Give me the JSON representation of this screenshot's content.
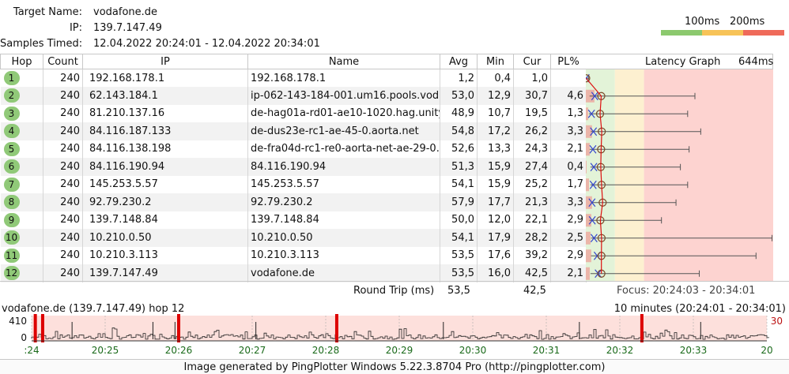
{
  "info": {
    "target_label": "Target Name:",
    "target_value": "vodafone.de",
    "ip_label": "IP:",
    "ip_value": "139.7.147.49",
    "samples_label": "Samples Timed:",
    "samples_value": "12.04.2022 20:24:01 - 12.04.2022 20:34:01"
  },
  "legend": {
    "label_100": "100ms",
    "label_200": "200ms",
    "colors": {
      "good": "#8cc96e",
      "warn": "#f7c358",
      "bad": "#ef6a5a"
    }
  },
  "table": {
    "headers": {
      "hop": "Hop",
      "count": "Count",
      "ip": "IP",
      "name": "Name",
      "avg": "Avg",
      "min": "Min",
      "cur": "Cur",
      "pl": "PL%",
      "graph": "Latency Graph",
      "scale": "644ms"
    },
    "rows": [
      {
        "hop": "1",
        "count": "240",
        "ip": "192.168.178.1",
        "name": "192.168.178.1",
        "avg": "1,2",
        "min": "0,4",
        "cur": "1,0",
        "pl": ""
      },
      {
        "hop": "2",
        "count": "240",
        "ip": "62.143.184.1",
        "name": "ip-062-143-184-001.um16.pools.vod",
        "avg": "53,0",
        "min": "12,9",
        "cur": "30,7",
        "pl": "4,6"
      },
      {
        "hop": "3",
        "count": "240",
        "ip": "81.210.137.16",
        "name": "de-hag01a-rd01-ae10-1020.hag.unity",
        "avg": "48,9",
        "min": "10,7",
        "cur": "19,5",
        "pl": "1,3"
      },
      {
        "hop": "4",
        "count": "240",
        "ip": "84.116.187.133",
        "name": "de-dus23e-rc1-ae-45-0.aorta.net",
        "avg": "54,8",
        "min": "17,2",
        "cur": "26,2",
        "pl": "3,3"
      },
      {
        "hop": "5",
        "count": "240",
        "ip": "84.116.138.198",
        "name": "de-fra04d-rc1-re0-aorta-net-ae-29-0.",
        "avg": "52,6",
        "min": "13,3",
        "cur": "24,3",
        "pl": "2,1"
      },
      {
        "hop": "6",
        "count": "240",
        "ip": "84.116.190.94",
        "name": "84.116.190.94",
        "avg": "51,3",
        "min": "15,9",
        "cur": "27,4",
        "pl": "0,4"
      },
      {
        "hop": "7",
        "count": "240",
        "ip": "145.253.5.57",
        "name": "145.253.5.57",
        "avg": "54,1",
        "min": "15,9",
        "cur": "25,2",
        "pl": "1,7"
      },
      {
        "hop": "8",
        "count": "240",
        "ip": "92.79.230.2",
        "name": "92.79.230.2",
        "avg": "57,9",
        "min": "17,7",
        "cur": "21,3",
        "pl": "3,3"
      },
      {
        "hop": "9",
        "count": "240",
        "ip": "139.7.148.84",
        "name": "139.7.148.84",
        "avg": "50,0",
        "min": "12,0",
        "cur": "22,1",
        "pl": "2,9"
      },
      {
        "hop": "10",
        "count": "240",
        "ip": "10.210.0.50",
        "name": "10.210.0.50",
        "avg": "54,1",
        "min": "17,9",
        "cur": "28,2",
        "pl": "2,5"
      },
      {
        "hop": "11",
        "count": "240",
        "ip": "10.210.3.113",
        "name": "10.210.3.113",
        "avg": "53,5",
        "min": "17,6",
        "cur": "39,2",
        "pl": "2,9"
      },
      {
        "hop": "12",
        "count": "240",
        "ip": "139.7.147.49",
        "name": "vodafone.de",
        "avg": "53,5",
        "min": "16,0",
        "cur": "42,5",
        "pl": "2,1"
      }
    ],
    "footer": {
      "label": "Round Trip (ms)",
      "avg": "53,5",
      "cur": "42,5",
      "focus": "Focus: 20:24:03 - 20:34:01"
    }
  },
  "latency_graph": {
    "scale_max_ms": 644,
    "zones_ms": {
      "good_end": 100,
      "warn_end": 200
    },
    "max_ms": [
      10,
      375,
      350,
      395,
      355,
      325,
      350,
      310,
      260,
      640,
      585,
      390
    ],
    "pl_fraction": [
      0,
      0.046,
      0.013,
      0.033,
      0.021,
      0.004,
      0.017,
      0.033,
      0.029,
      0.025,
      0.029,
      0.021
    ]
  },
  "timeline": {
    "title": "vodafone.de (139.7.147.49) hop 12",
    "range": "10 minutes (20:24:01 - 20:34:01)",
    "y_max_label": "410",
    "y_min_label": "0",
    "right_label": "30",
    "time_labels": [
      ":24",
      "20:25",
      "20:26",
      "20:27",
      "20:28",
      "20:29",
      "20:30",
      "20:31",
      "20:32",
      "20:33",
      "20"
    ],
    "loss_minutes": [
      0.05,
      0.15,
      2.0,
      4.15,
      8.3
    ],
    "spike_minutes": [
      0.55,
      1.65,
      1.95,
      3.05,
      5.6,
      7.45,
      9.1
    ]
  },
  "credit": "Image generated by PingPlotter Windows 5.22.3.8704 Pro (http://pingplotter.com)"
}
